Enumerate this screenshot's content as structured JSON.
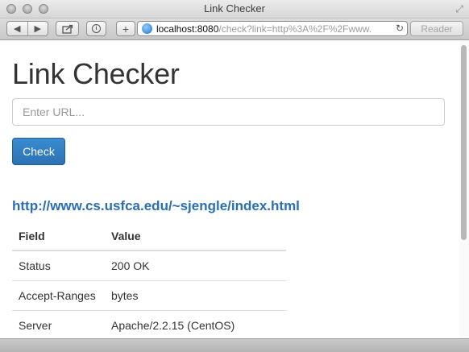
{
  "window": {
    "title": "Link Checker"
  },
  "toolbar": {
    "back_icon": "◀",
    "forward_icon": "▶",
    "plus_label": "+",
    "url_host": "localhost:8080",
    "url_rest": "/check?link=http%3A%2F%2Fwww.",
    "reload_icon": "↻",
    "reader_label": "Reader"
  },
  "page": {
    "heading": "Link Checker",
    "url_input": {
      "placeholder": "Enter URL...",
      "value": ""
    },
    "check_button_label": "Check",
    "result_link": "http://www.cs.usfca.edu/~sjengle/index.html",
    "table": {
      "headers": [
        "Field",
        "Value"
      ],
      "rows": [
        [
          "Status",
          "200 OK"
        ],
        [
          "Accept-Ranges",
          "bytes"
        ],
        [
          "Server",
          "Apache/2.2.15 (CentOS)"
        ]
      ]
    }
  },
  "colors": {
    "link": "#2a6fb5",
    "button": "#2c72b5"
  }
}
